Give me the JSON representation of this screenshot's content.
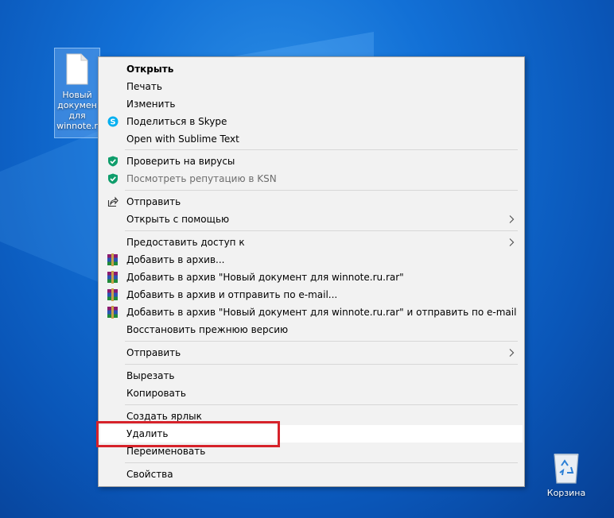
{
  "desktop": {
    "file_icon": {
      "label": "Новый\nдокумен\nдля\nwinnote.r",
      "icon": "text-file-icon"
    },
    "recycle_bin": {
      "label": "Корзина",
      "icon": "recycle-bin-icon"
    }
  },
  "context_menu": {
    "items": [
      {
        "label": "Открыть",
        "bold": true
      },
      {
        "label": "Печать"
      },
      {
        "label": "Изменить"
      },
      {
        "label": "Поделиться в Skype",
        "icon": "skype-icon"
      },
      {
        "label": "Open with Sublime Text"
      },
      {
        "label": "Проверить на вирусы",
        "icon": "kaspersky-shield-icon"
      },
      {
        "label": "Посмотреть репутацию в KSN",
        "icon": "kaspersky-shield-icon",
        "disabled": true
      },
      {
        "label": "Отправить",
        "icon": "share-icon"
      },
      {
        "label": "Открыть с помощью",
        "submenu": true
      },
      {
        "label": "Предоставить доступ к",
        "submenu": true
      },
      {
        "label": "Добавить в архив...",
        "icon": "winrar-icon"
      },
      {
        "label": "Добавить в архив \"Новый документ для winnote.ru.rar\"",
        "icon": "winrar-icon"
      },
      {
        "label": "Добавить в архив и отправить по e-mail...",
        "icon": "winrar-icon"
      },
      {
        "label": "Добавить в архив \"Новый документ для winnote.ru.rar\" и отправить по e-mail",
        "icon": "winrar-icon"
      },
      {
        "label": "Восстановить прежнюю версию"
      },
      {
        "label": "Отправить",
        "submenu": true
      },
      {
        "label": "Вырезать"
      },
      {
        "label": "Копировать"
      },
      {
        "label": "Создать ярлык"
      },
      {
        "label": "Удалить",
        "highlighted": true
      },
      {
        "label": "Переименовать"
      },
      {
        "label": "Свойства"
      }
    ]
  },
  "colors": {
    "menu_bg": "#f2f2f2",
    "highlight_border": "#d6222a",
    "kaspersky_green": "#0f9d6b",
    "skype_blue": "#00aff0"
  }
}
